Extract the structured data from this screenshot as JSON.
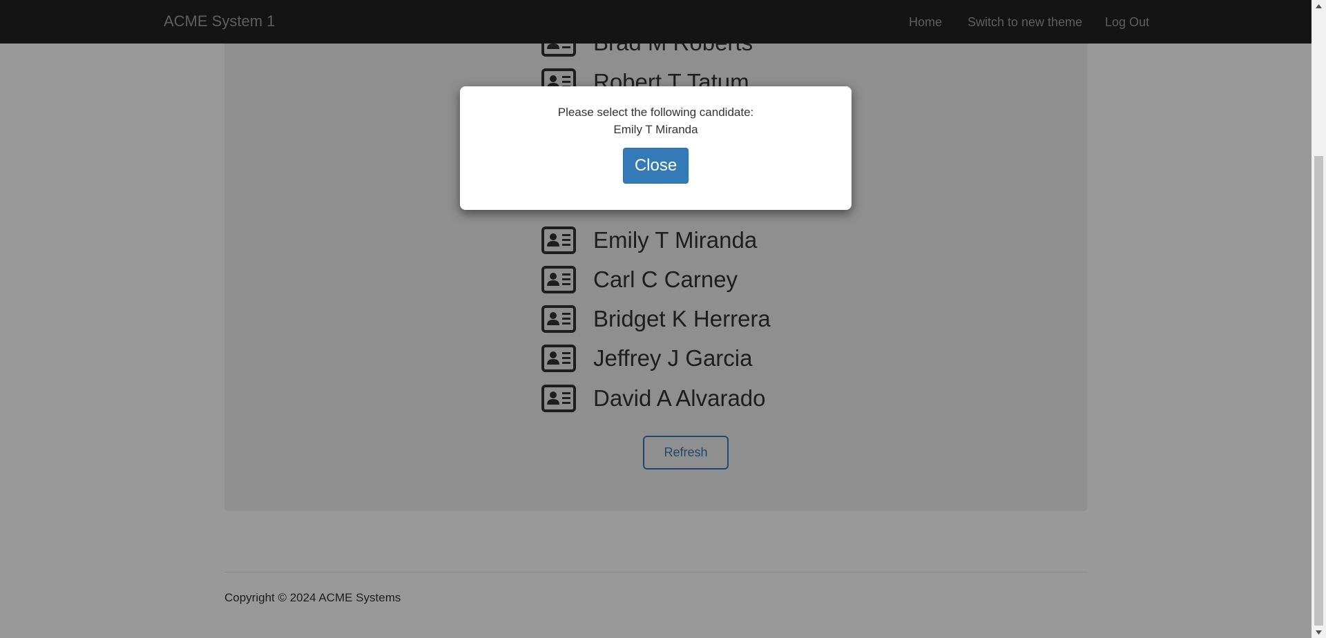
{
  "navbar": {
    "brand": "ACME System 1",
    "links": {
      "home": "Home",
      "switch_theme": "Switch to new theme",
      "logout": "Log Out"
    }
  },
  "candidates": [
    "Brad M Roberts",
    "Robert T Tatum",
    "",
    "",
    "Emily T Miranda",
    "Carl C Carney",
    "Bridget K Herrera",
    "Jeffrey J Garcia",
    "David A Alvarado"
  ],
  "refresh_label": "Refresh",
  "footer": {
    "copyright": "Copyright © 2024 ACME Systems"
  },
  "modal": {
    "line1": "Please select the following candidate:",
    "line2": "Emily T Miranda",
    "close_label": "Close"
  },
  "icons": {
    "candidate": "id-card-icon",
    "scroll_up": "triangle-up-icon",
    "scroll_down": "triangle-down-icon"
  },
  "colors": {
    "navbar": "#222222",
    "primary": "#337ab7",
    "panel": "#eeeeee"
  }
}
